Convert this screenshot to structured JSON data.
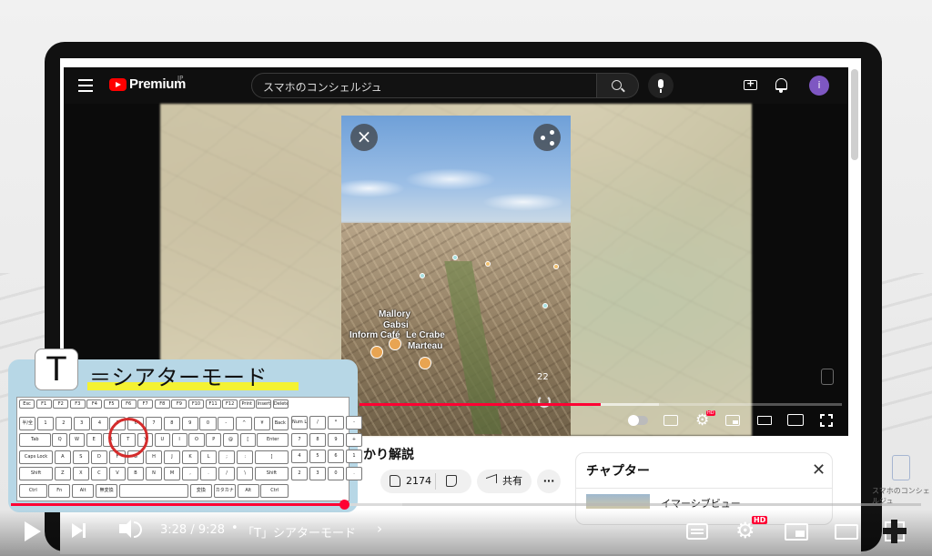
{
  "app": {
    "logo_text": "Premium",
    "logo_region": "JP"
  },
  "header": {
    "search_query": "スマホのコンシェルジュ",
    "avatar_letter": "i"
  },
  "video": {
    "place_labels": [
      "Mallory",
      "Gabsi",
      "Inform Café",
      "Le Crabe",
      "Marteau"
    ],
    "counter": "22",
    "progress_fraction": 0.5,
    "buffered_fraction": 0.62
  },
  "below_video": {
    "title_fragment": "っかり解説",
    "like_count": "2174",
    "share_label": "共有",
    "more_label": "···"
  },
  "chapters_panel": {
    "title": "チャプター",
    "first_item": "イマーシブビュー"
  },
  "channel_watermark_text": "スマホのコンシェルジュ",
  "overlay": {
    "key_letter": "T",
    "mode_text": "＝シアターモード",
    "keyboard_rows": [
      [
        "Esc",
        "F1",
        "F2",
        "F3",
        "F4",
        "F5",
        "F6",
        "F7",
        "F8",
        "F9",
        "F10",
        "F11",
        "F12",
        "Print",
        "Insert",
        "Delete"
      ],
      [
        "半/全",
        "1",
        "2",
        "3",
        "4",
        "5",
        "6",
        "7",
        "8",
        "9",
        "0",
        "-",
        "^",
        "¥",
        "Back"
      ],
      [
        "Tab",
        "Q",
        "W",
        "E",
        "R",
        "T",
        "Y",
        "U",
        "I",
        "O",
        "P",
        "@",
        "[",
        "Enter"
      ],
      [
        "Caps Lock",
        "A",
        "S",
        "D",
        "F",
        "G",
        "H",
        "J",
        "K",
        "L",
        ";",
        ":",
        "]"
      ],
      [
        "Shift",
        "Z",
        "X",
        "C",
        "V",
        "B",
        "N",
        "M",
        ",",
        ".",
        "/",
        "\\",
        "Shift"
      ],
      [
        "Ctrl",
        "Fn",
        "Alt",
        "無変換",
        "",
        "変換",
        "カタカナ",
        "Alt",
        "Ctrl"
      ]
    ],
    "numpad_keys": [
      "Num Lock",
      "/",
      "*",
      "-",
      "7",
      "8",
      "9",
      "+",
      "4",
      "5",
      "6",
      "1",
      "2",
      "3",
      "0",
      "."
    ]
  },
  "player": {
    "current_time": "3:28",
    "duration": "9:28",
    "time_display": "3:28 / 9:28",
    "separator": "•",
    "chapter_label": "「T」シアターモード",
    "chevron": "›",
    "hd_badge": "HD",
    "progress_fraction": 0.366,
    "buffered_fraction": 0.43
  },
  "colors": {
    "accent_red": "#ff0033",
    "overlay_blue": "#b7d7e6",
    "highlight_yellow": "#f4f232",
    "avatar_purple": "#7e57c2"
  },
  "icons": [
    "menu-icon",
    "youtube-logo-icon",
    "search-icon",
    "mic-icon",
    "create-icon",
    "bell-icon",
    "close-icon",
    "share-icon",
    "like-icon",
    "dislike-icon",
    "settings-gear-icon",
    "subtitles-icon",
    "miniplayer-icon",
    "theater-icon",
    "cast-icon",
    "fullscreen-icon",
    "play-icon",
    "next-icon",
    "volume-icon"
  ]
}
